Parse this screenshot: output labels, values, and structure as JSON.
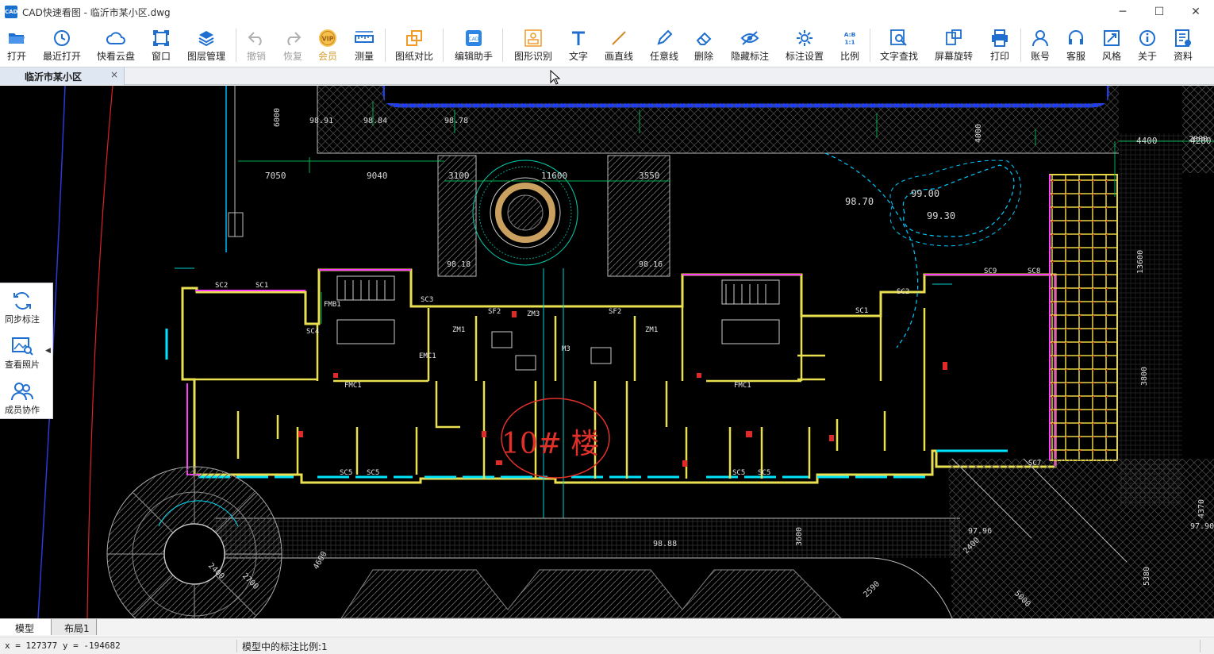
{
  "window": {
    "title": "CAD快速看图 - 临沂市某小区.dwg",
    "app_icon_text": "CAD",
    "controls": [
      "─",
      "☐",
      "✕"
    ]
  },
  "toolbar": {
    "items": [
      {
        "label": "打开",
        "icon": "folder-open-icon",
        "disabled": false
      },
      {
        "label": "最近打开",
        "icon": "clock-icon",
        "disabled": false
      },
      {
        "label": "快看云盘",
        "icon": "cloud-icon",
        "disabled": false
      },
      {
        "label": "窗口",
        "icon": "window-icon",
        "disabled": false
      },
      {
        "label": "图层管理",
        "icon": "layers-icon",
        "disabled": false
      },
      {
        "label": "撤销",
        "icon": "undo-icon",
        "disabled": true
      },
      {
        "label": "恢复",
        "icon": "redo-icon",
        "disabled": true
      },
      {
        "label": "会员",
        "icon": "vip-icon",
        "disabled": false,
        "badge": "VIP"
      },
      {
        "label": "测量",
        "icon": "ruler-icon",
        "disabled": false
      },
      {
        "label": "图纸对比",
        "icon": "compare-icon",
        "disabled": false
      },
      {
        "label": "编辑助手",
        "icon": "edit-assistant-icon",
        "disabled": false
      },
      {
        "label": "图形识别",
        "icon": "shape-recognize-icon",
        "disabled": false
      },
      {
        "label": "文字",
        "icon": "text-icon",
        "disabled": false
      },
      {
        "label": "画直线",
        "icon": "line-icon",
        "disabled": false
      },
      {
        "label": "任意线",
        "icon": "pencil-icon",
        "disabled": false
      },
      {
        "label": "删除",
        "icon": "eraser-icon",
        "disabled": false
      },
      {
        "label": "隐藏标注",
        "icon": "eye-hide-icon",
        "disabled": false
      },
      {
        "label": "标注设置",
        "icon": "annotation-settings-icon",
        "disabled": false
      },
      {
        "label": "比例",
        "icon": "scale-icon",
        "disabled": false,
        "badge": "A:B 1:1"
      },
      {
        "label": "文字查找",
        "icon": "find-text-icon",
        "disabled": false
      },
      {
        "label": "屏幕旋转",
        "icon": "rotate-screen-icon",
        "disabled": false
      },
      {
        "label": "打印",
        "icon": "printer-icon",
        "disabled": false
      },
      {
        "label": "账号",
        "icon": "user-icon",
        "disabled": false
      },
      {
        "label": "客服",
        "icon": "headset-icon",
        "disabled": false
      },
      {
        "label": "风格",
        "icon": "style-icon",
        "disabled": false
      },
      {
        "label": "关于",
        "icon": "info-icon",
        "disabled": false
      },
      {
        "label": "资料",
        "icon": "documents-icon",
        "disabled": false
      }
    ]
  },
  "doc_tab": {
    "label": "临沂市某小区",
    "close": "×"
  },
  "side_panel": {
    "items": [
      {
        "label": "同步标注",
        "icon": "sync-icon"
      },
      {
        "label": "查看照片",
        "icon": "photo-search-icon"
      },
      {
        "label": "成员协作",
        "icon": "team-icon"
      }
    ],
    "toggle": "◀"
  },
  "drawing": {
    "annotation_text": "10# 楼",
    "dimensions": [
      "7050",
      "9040",
      "3100",
      "11600",
      "3550",
      "6000",
      "4400",
      "4280",
      "13600",
      "3800",
      "4000",
      "5000",
      "5380",
      "2400",
      "2590",
      "3600",
      "2400",
      "4600",
      "2700",
      "2000",
      "4370"
    ],
    "elevations": [
      "98.70",
      "99.00",
      "99.30",
      "98.18",
      "98.16",
      "97.90",
      "98.91",
      "98.84",
      "98.78",
      "97.96",
      "98.88"
    ],
    "labels": [
      "SC2",
      "SC1",
      "SC4",
      "SC5",
      "SC3",
      "SC9",
      "SC8",
      "SC7",
      "SF2",
      "ZM1",
      "ZM3",
      "M3",
      "FMB1",
      "FMC1",
      "EMC1"
    ]
  },
  "layout_tabs": {
    "model": "模型",
    "layout1": "布局1"
  },
  "status": {
    "coords": "x = 127377  y = -194682",
    "scale_text": "模型中的标注比例:1"
  },
  "colors": {
    "canvas_bg": "#000000",
    "wall_yellow": "#f0f05a",
    "wall_magenta": "#ff40ff",
    "window_cyan": "#00e5ff",
    "grid_green": "#00b050",
    "annotation_red": "#e0302a"
  }
}
